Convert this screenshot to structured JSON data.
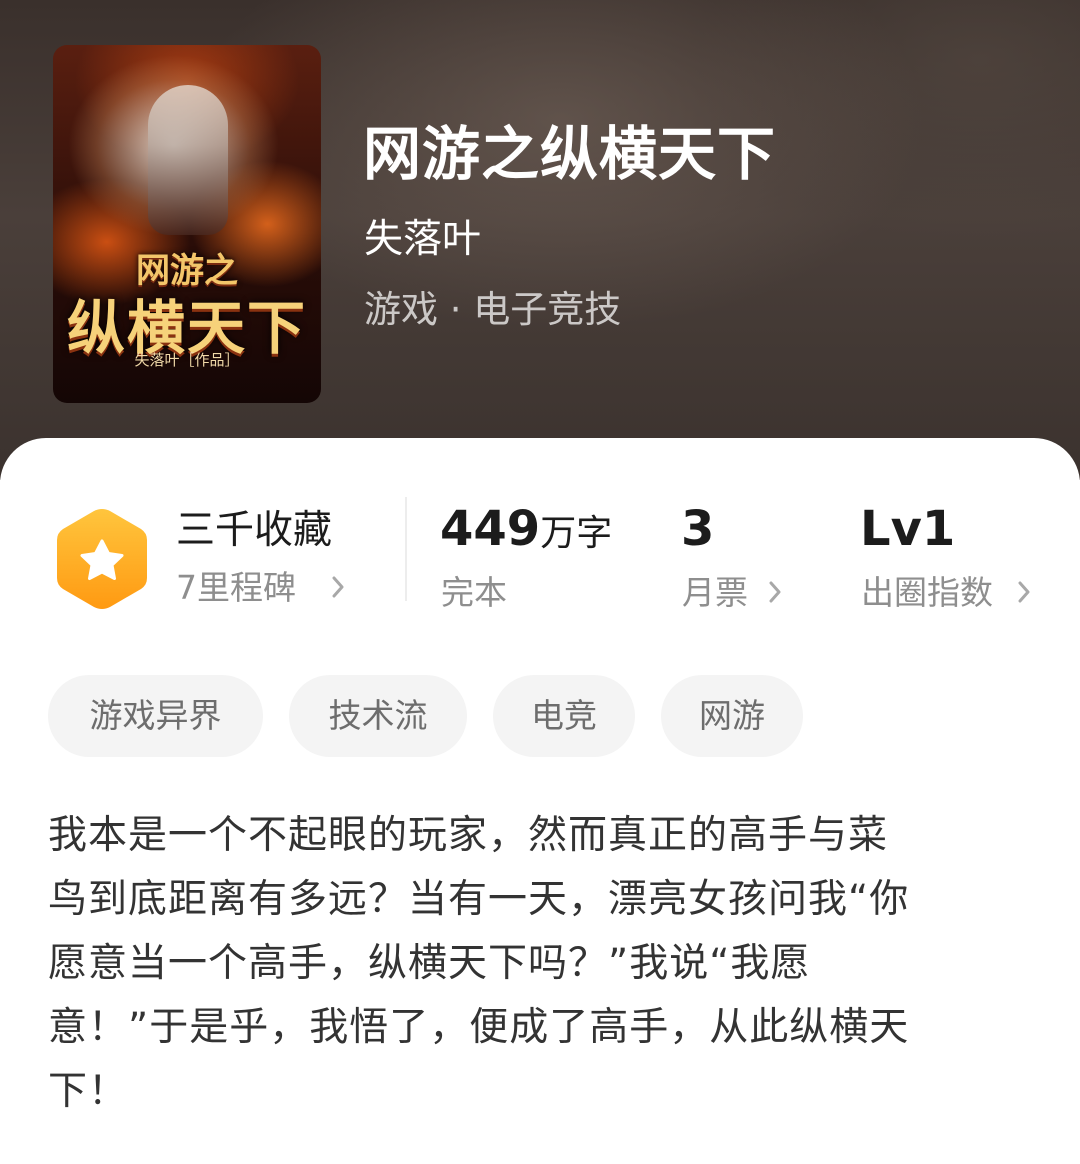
{
  "book": {
    "title": "网游之纵横天下",
    "author": "失落叶",
    "genre": "游戏 · 电子竞技"
  },
  "cover": {
    "title_line1": "网游之",
    "title_line2": "纵横天下",
    "byline": "失落叶［作品］"
  },
  "stats": {
    "collection": {
      "title": "三千收藏",
      "subtitle": "7里程碑",
      "icon": "star-icon"
    },
    "words": {
      "value": "449",
      "unit": "万字",
      "label": "完本"
    },
    "tickets": {
      "value": "3",
      "label": "月票"
    },
    "influence": {
      "value": "Lv1",
      "label": "出圈指数"
    }
  },
  "tags": [
    "游戏异界",
    "技术流",
    "电竞",
    "网游"
  ],
  "synopsis_lines": [
    "我本是一个不起眼的玩家，然而真正的高手与菜",
    "鸟到底距离有多远？当有一天，漂亮女孩问我“你",
    "愿意当一个高手，纵横天下吗？”我说“我愿",
    "意！”于是乎，我悟了，便成了高手，从此纵横天",
    "下！"
  ],
  "colors": {
    "badge_top": "#ffc53d",
    "badge_bottom": "#ff9f1a",
    "text_primary": "#1c1c1c",
    "text_secondary": "#8e8e8e",
    "tag_bg": "#f4f4f4"
  }
}
